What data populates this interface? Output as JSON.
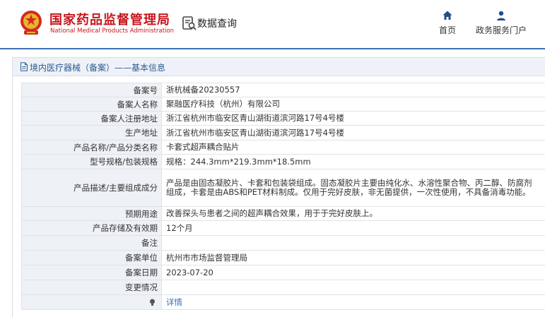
{
  "header": {
    "org_name_cn": "国家药品监督管理局",
    "org_name_en": "National Medical Products Administration",
    "query_label": "数据查询",
    "nav": {
      "home_label": "首页",
      "gov_services_label": "政务服务门户"
    }
  },
  "breadcrumb": {
    "text": "境内医疗器械（备案）——基本信息"
  },
  "record": {
    "rows": [
      {
        "label": "备案号",
        "value": "浙杭械备20230557"
      },
      {
        "label": "备案人名称",
        "value": "聚融医疗科技（杭州）有限公司"
      },
      {
        "label": "备案人注册地址",
        "value": "浙江省杭州市临安区青山湖街道滨河路17号4号楼"
      },
      {
        "label": "生产地址",
        "value": "浙江省杭州市临安区青山湖街道滨河路17号4号楼"
      },
      {
        "label": "产品名称/产品分类名称",
        "value": "卡套式超声耦合贴片"
      },
      {
        "label": "型号规格/包装规格",
        "value": "规格：244.3mm*219.3mm*18.5mm"
      },
      {
        "label": "产品描述/主要组成成分",
        "value": "产品是由固态凝胶片、卡套和包装袋组成。固态凝胶片主要由纯化水、水溶性聚合物、丙二醇、防腐剂组成，卡套是由ABS和PET材料制成。仅用于完好皮肤，非无菌提供，一次性使用，不具备消毒功能。"
      },
      {
        "label": "预期用途",
        "value": "改善探头与患者之间的超声耦合效果，用于于完好皮肤上。"
      },
      {
        "label": "产品存储及有效期",
        "value": "12个月"
      },
      {
        "label": "备注",
        "value": ""
      },
      {
        "label": "备案单位",
        "value": "杭州市市场监督管理局"
      },
      {
        "label": "备案日期",
        "value": "2023-07-20"
      },
      {
        "label": "变更情况",
        "value": ""
      }
    ],
    "detail_link_label": "详情"
  },
  "colors": {
    "brand_red": "#c8161e",
    "accent_blue": "#2b5a93",
    "link_blue": "#2b6fc2",
    "label_bg": "#eef1f5"
  }
}
